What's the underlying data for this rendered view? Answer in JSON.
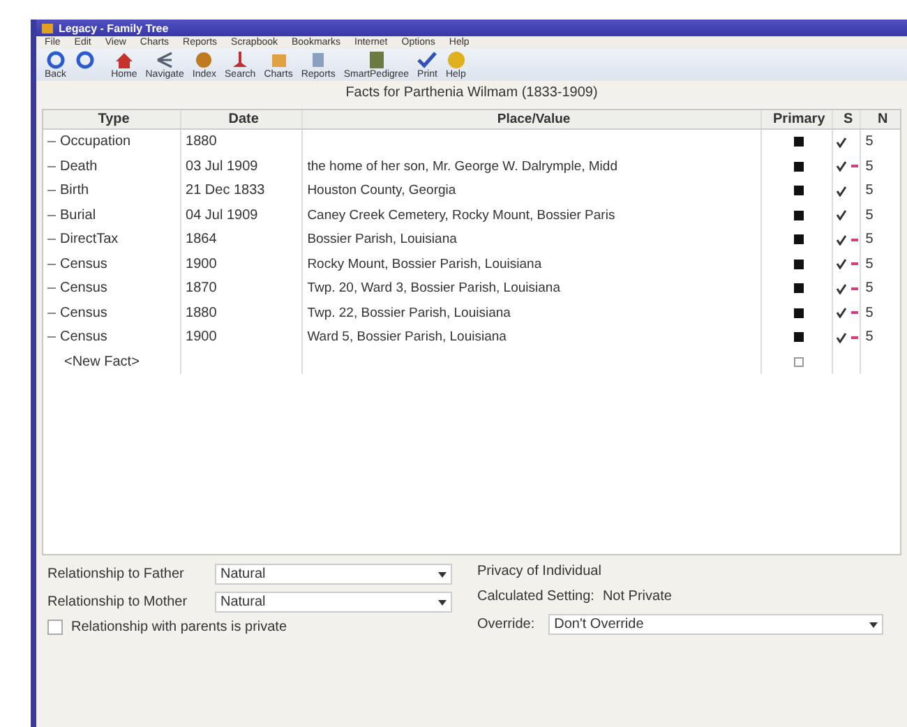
{
  "window": {
    "title": "Legacy - Family Tree"
  },
  "menu": [
    "File",
    "Edit",
    "View",
    "Charts",
    "Reports",
    "Scrapbook",
    "Bookmarks",
    "Internet",
    "Options",
    "Help"
  ],
  "toolbar": [
    {
      "kind": "labeled",
      "label": "Back"
    },
    {
      "kind": "icon_only"
    },
    {
      "kind": "labeled",
      "label": "Home"
    },
    {
      "kind": "labeled",
      "label": "Navigate"
    },
    {
      "kind": "labeled",
      "label": "Index"
    },
    {
      "kind": "labeled",
      "label": "Search"
    },
    {
      "kind": "labeled",
      "label": "Charts"
    },
    {
      "kind": "labeled",
      "label": "Reports"
    },
    {
      "kind": "labeled",
      "label": "SmartPedigree"
    },
    {
      "kind": "labeled",
      "label": "Print"
    },
    {
      "kind": "labeled",
      "label": "Help"
    }
  ],
  "heading": "Facts for Parthenia Wilmam (1833-1909)",
  "table": {
    "columns": [
      "Type",
      "Date",
      "Place/Value",
      "Primary",
      "S",
      "N"
    ],
    "rows": [
      {
        "kind": "fact",
        "type": "Occupation",
        "date": "1880",
        "primary": true,
        "sourced": true,
        "media": false,
        "n": "5"
      },
      {
        "kind": "fact",
        "type": "Death",
        "date": "03 Jul 1909",
        "place": "the home of her son, Mr. George W. Dalrymple, Midd",
        "primary": true,
        "sourced": true,
        "media": true,
        "n": "5"
      },
      {
        "kind": "fact",
        "type": "Birth",
        "date": "21 Dec 1833",
        "place": "Houston County, Georgia",
        "primary": true,
        "sourced": true,
        "media": false,
        "n": "5"
      },
      {
        "kind": "fact",
        "type": "Burial",
        "date": "04 Jul 1909",
        "place": "Caney Creek Cemetery, Rocky Mount, Bossier Paris",
        "primary": true,
        "sourced": true,
        "media": false,
        "n": "5"
      },
      {
        "kind": "fact",
        "type": "DirectTax",
        "date": "1864",
        "place": "Bossier Parish, Louisiana",
        "primary": true,
        "sourced": true,
        "media": true,
        "n": "5"
      },
      {
        "kind": "fact",
        "type": "Census",
        "date": "1900",
        "place": "Rocky Mount, Bossier Parish, Louisiana",
        "primary": true,
        "sourced": true,
        "media": true,
        "n": "5"
      },
      {
        "kind": "fact",
        "type": "Census",
        "date": "1870",
        "place": "Twp. 20, Ward 3, Bossier Parish, Louisiana",
        "primary": true,
        "sourced": true,
        "media": true,
        "n": "5"
      },
      {
        "kind": "fact",
        "type": "Census",
        "date": "1880",
        "place": "Twp. 22, Bossier Parish, Louisiana",
        "primary": true,
        "sourced": true,
        "media": true,
        "n": "5"
      },
      {
        "kind": "fact",
        "type": "Census",
        "date": "1900",
        "place": "Ward 5, Bossier Parish, Louisiana",
        "primary": true,
        "sourced": true,
        "media": true,
        "n": "5"
      },
      {
        "kind": "new",
        "type": "<New Fact>",
        "primary": false
      }
    ]
  },
  "relationships": [
    {
      "label": "Relationship to Father",
      "value": "Natural"
    },
    {
      "label": "Relationship to Mother",
      "value": "Natural"
    }
  ],
  "private_checkbox": {
    "label": "Relationship with parents is private",
    "checked": false
  },
  "privacy": {
    "title": "Privacy of Individual",
    "calculated_label": "Calculated Setting:",
    "calculated_value": "Not Private",
    "override_label": "Override:",
    "override_value": "Don't Override"
  }
}
